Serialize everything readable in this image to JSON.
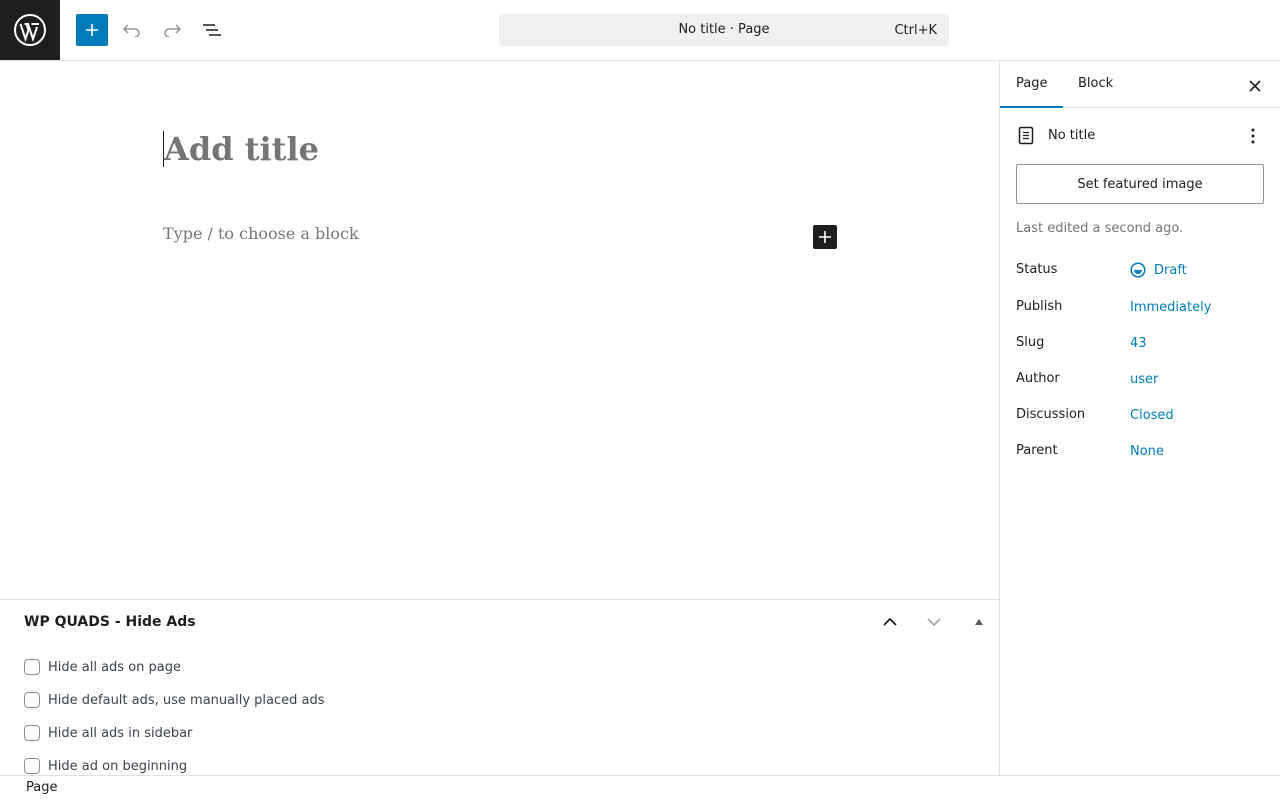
{
  "topbar": {
    "command_title": "No title · Page",
    "command_shortcut": "Ctrl+K"
  },
  "editor": {
    "title_placeholder": "Add title",
    "block_placeholder": "Type / to choose a block"
  },
  "metabox": {
    "title": "WP QUADS - Hide Ads",
    "options": [
      {
        "label": "Hide all ads on page",
        "checked": false
      },
      {
        "label": "Hide default ads, use manually placed ads",
        "checked": false
      },
      {
        "label": "Hide all ads in sidebar",
        "checked": false
      },
      {
        "label": "Hide ad on beginning",
        "checked": false
      }
    ]
  },
  "footer": {
    "breadcrumb": "Page"
  },
  "sidebar": {
    "tabs": [
      "Page",
      "Block"
    ],
    "active_tab": "Page",
    "doc_title": "No title",
    "featured_button": "Set featured image",
    "last_edited": "Last edited a second ago.",
    "properties": [
      {
        "label": "Status",
        "value": "Draft"
      },
      {
        "label": "Publish",
        "value": "Immediately"
      },
      {
        "label": "Slug",
        "value": "43"
      },
      {
        "label": "Author",
        "value": "user"
      },
      {
        "label": "Discussion",
        "value": "Closed"
      },
      {
        "label": "Parent",
        "value": "None"
      }
    ]
  },
  "colors": {
    "accent": "#007cba",
    "dark": "#1e1e1e",
    "placeholder": "#757575"
  }
}
